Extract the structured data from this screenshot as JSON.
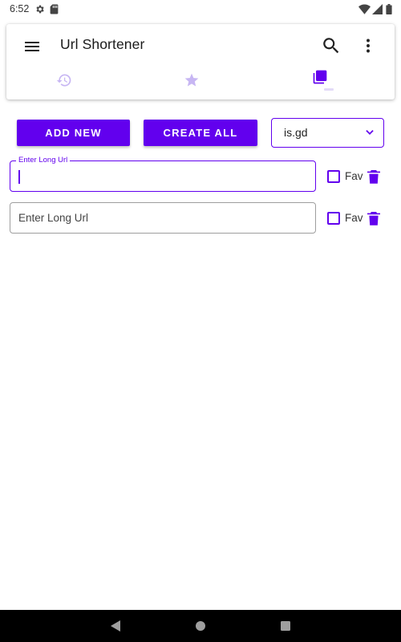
{
  "status_bar": {
    "time": "6:52",
    "icons": [
      "gear-icon",
      "sd-card-icon",
      "wifi-icon",
      "signal-icon",
      "battery-icon"
    ]
  },
  "app_bar": {
    "title": "Url Shortener",
    "menu_icon": "hamburger-menu-icon",
    "actions": [
      "search-icon",
      "more-vert-icon"
    ]
  },
  "tabs": [
    {
      "icon": "history-icon",
      "selected": false
    },
    {
      "icon": "star-icon",
      "selected": false
    },
    {
      "icon": "library-icon",
      "selected": true
    }
  ],
  "toolbar": {
    "add_new_label": "ADD NEW",
    "create_all_label": "CREATE ALL",
    "service_selected": "is.gd"
  },
  "url_rows": [
    {
      "label": "Enter Long Url",
      "value": "",
      "focused": true,
      "fav_label": "Fav",
      "fav_checked": false
    },
    {
      "placeholder": "Enter Long Url",
      "value": "",
      "focused": false,
      "fav_label": "Fav",
      "fav_checked": false
    }
  ],
  "colors": {
    "accent": "#6200ee",
    "tab_inactive": "#c7b6f3",
    "nav_background": "#000000"
  }
}
